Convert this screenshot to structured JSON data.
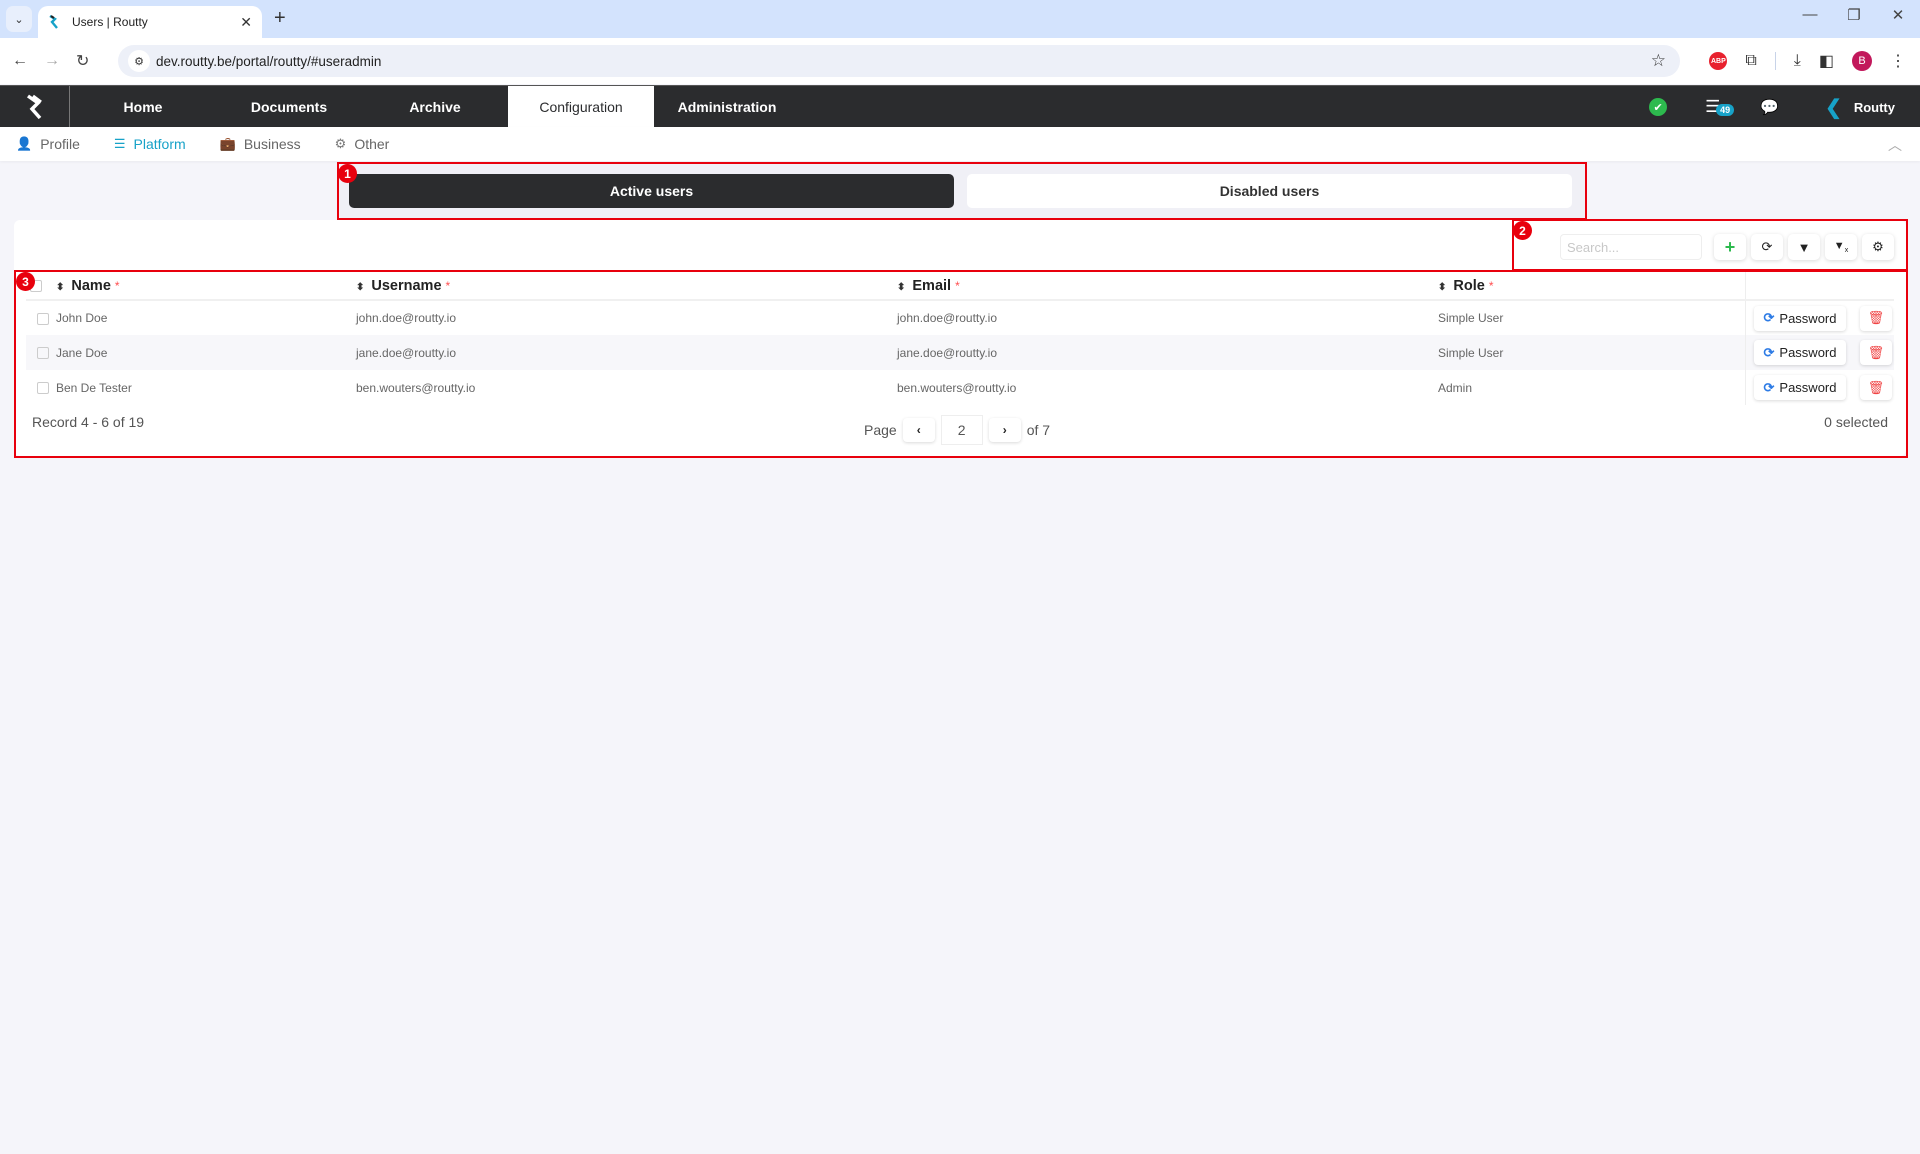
{
  "browser": {
    "tab_title": "Users | Routty",
    "url": "dev.routty.be/portal/routty/#useradmin",
    "new_tab": "+",
    "close_tab": "✕",
    "profile_initial": "B",
    "abp_label": "ABP"
  },
  "app_nav": {
    "items": [
      {
        "label": "Home",
        "active": false
      },
      {
        "label": "Documents",
        "active": false
      },
      {
        "label": "Archive",
        "active": false
      },
      {
        "label": "Configuration",
        "active": true
      },
      {
        "label": "Administration",
        "active": false
      }
    ],
    "notification_count": "49",
    "brand_name": "Routty",
    "status_color": "#2dba4e",
    "accent_color": "#17a2c8"
  },
  "sub_nav": {
    "items": [
      {
        "label": "Profile",
        "icon": "user-icon",
        "active": false
      },
      {
        "label": "Platform",
        "icon": "database-icon",
        "active": true
      },
      {
        "label": "Business",
        "icon": "briefcase-icon",
        "active": false
      },
      {
        "label": "Other",
        "icon": "gear-icon",
        "active": false
      }
    ]
  },
  "user_tabs": {
    "active_label": "Active users",
    "disabled_label": "Disabled users"
  },
  "toolbar": {
    "search_placeholder": "Search...",
    "buttons": [
      "add",
      "refresh",
      "filter",
      "clear-filter",
      "settings"
    ]
  },
  "table": {
    "columns": [
      {
        "label": "Name",
        "required": "*"
      },
      {
        "label": "Username",
        "required": "*"
      },
      {
        "label": "Email",
        "required": "*"
      },
      {
        "label": "Role",
        "required": "*"
      }
    ],
    "rows": [
      {
        "name": "John Doe",
        "username": "john.doe@routty.io",
        "email": "john.doe@routty.io",
        "role": "Simple User"
      },
      {
        "name": "Jane Doe",
        "username": "jane.doe@routty.io",
        "email": "jane.doe@routty.io",
        "role": "Simple User"
      },
      {
        "name": "Ben De Tester",
        "username": "ben.wouters@routty.io",
        "email": "ben.wouters@routty.io",
        "role": "Admin"
      }
    ],
    "password_label": "Password"
  },
  "footer": {
    "record_text": "Record 4 - 6 of 19",
    "page_label": "Page",
    "current_page": "2",
    "total_pages_text": "of 7",
    "selected_text": "0 selected"
  },
  "annotations": [
    {
      "label": "1"
    },
    {
      "label": "2"
    },
    {
      "label": "3"
    }
  ]
}
